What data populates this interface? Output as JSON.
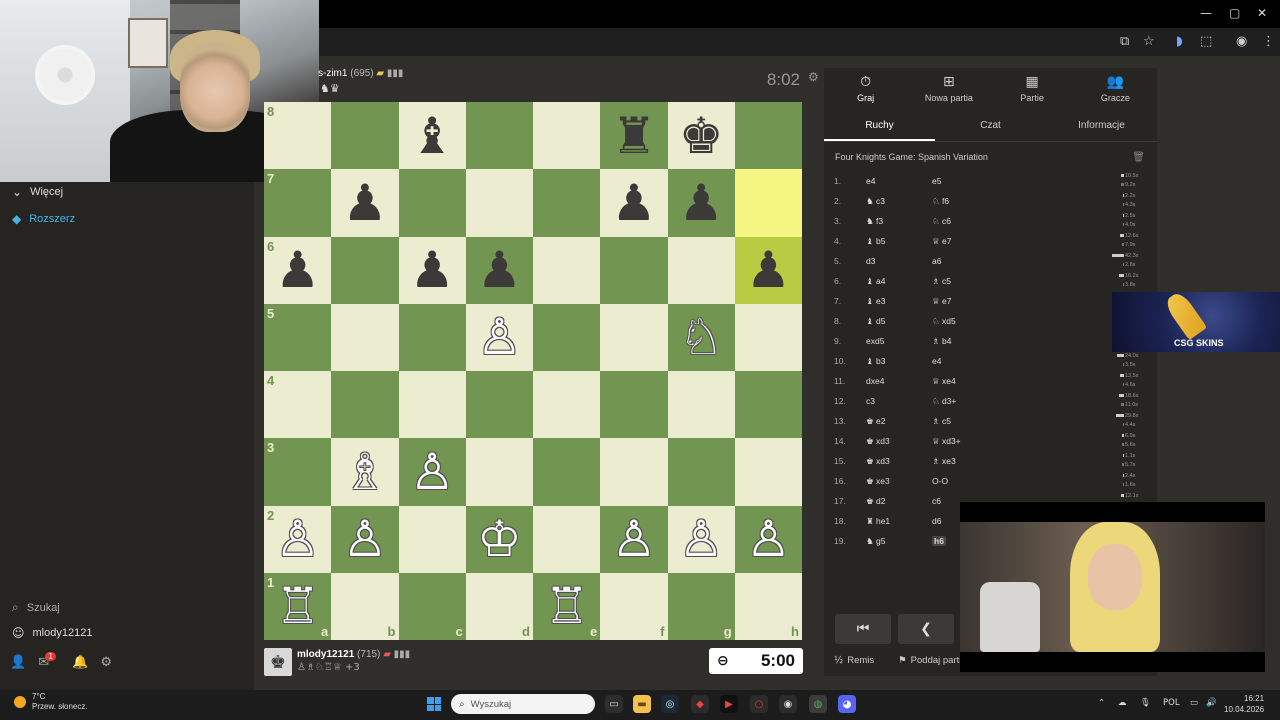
{
  "window": {
    "minimize": "—",
    "maximize": "▢",
    "close": "✕"
  },
  "sidebar": {
    "items": [
      {
        "label": "Więcej",
        "icon": "chevron-down-icon",
        "glyph": "⌄"
      },
      {
        "label": "Rozszerz",
        "icon": "gem-icon",
        "glyph": "◆"
      },
      {
        "label": "Szukaj",
        "icon": "search-icon",
        "glyph": "⌕"
      },
      {
        "label": "mlody12121",
        "icon": "avatar",
        "glyph": "☺"
      }
    ],
    "notification_count": "1"
  },
  "opponent": {
    "name": "s-zim1",
    "rating": "(695)",
    "captured": "♞♛",
    "clock": "8:02"
  },
  "player": {
    "name": "mlody12121",
    "rating": "(715)",
    "captured": "♙♗♘♖♕",
    "captured_extra": "+3",
    "clock": "5:00"
  },
  "board": {
    "files": [
      "a",
      "b",
      "c",
      "d",
      "e",
      "f",
      "g",
      "h"
    ],
    "ranks": [
      "8",
      "7",
      "6",
      "5",
      "4",
      "3",
      "2",
      "1"
    ],
    "highlight": [
      "h7",
      "h6"
    ],
    "pieces": [
      {
        "sq": "c8",
        "glyph": "♝",
        "color": "b"
      },
      {
        "sq": "f8",
        "glyph": "♜",
        "color": "b"
      },
      {
        "sq": "g8",
        "glyph": "♚",
        "color": "b"
      },
      {
        "sq": "b7",
        "glyph": "♟",
        "color": "b"
      },
      {
        "sq": "f7",
        "glyph": "♟",
        "color": "b"
      },
      {
        "sq": "g7",
        "glyph": "♟",
        "color": "b"
      },
      {
        "sq": "a6",
        "glyph": "♟",
        "color": "b"
      },
      {
        "sq": "c6",
        "glyph": "♟",
        "color": "b"
      },
      {
        "sq": "d6",
        "glyph": "♟",
        "color": "b"
      },
      {
        "sq": "h6",
        "glyph": "♟",
        "color": "b"
      },
      {
        "sq": "d5",
        "glyph": "♙",
        "color": "w"
      },
      {
        "sq": "g5",
        "glyph": "♘",
        "color": "w"
      },
      {
        "sq": "b3",
        "glyph": "♗",
        "color": "w"
      },
      {
        "sq": "c3",
        "glyph": "♙",
        "color": "w"
      },
      {
        "sq": "a2",
        "glyph": "♙",
        "color": "w"
      },
      {
        "sq": "b2",
        "glyph": "♙",
        "color": "w"
      },
      {
        "sq": "d2",
        "glyph": "♔",
        "color": "w"
      },
      {
        "sq": "f2",
        "glyph": "♙",
        "color": "w"
      },
      {
        "sq": "g2",
        "glyph": "♙",
        "color": "w"
      },
      {
        "sq": "h2",
        "glyph": "♙",
        "color": "w"
      },
      {
        "sq": "a1",
        "glyph": "♖",
        "color": "w"
      },
      {
        "sq": "e1",
        "glyph": "♖",
        "color": "w"
      }
    ]
  },
  "panel": {
    "tabs": [
      {
        "label": "Graj",
        "glyph": "⏱"
      },
      {
        "label": "Nowa partia",
        "glyph": "⊞"
      },
      {
        "label": "Partie",
        "glyph": "▦"
      },
      {
        "label": "Gracze",
        "glyph": "👥"
      }
    ],
    "subtabs": [
      "Ruchy",
      "Czat",
      "Informacje"
    ],
    "opening": "Four Knights Game: Spanish Variation",
    "moves": [
      {
        "n": "1.",
        "w": "e4",
        "b": "e5",
        "tw": "10.5s",
        "tb": "9.2s",
        "fw": 0.25,
        "fb": 0.22
      },
      {
        "n": "2.",
        "w": "♞ c3",
        "b": "♘ f6",
        "tw": "2.2s",
        "tb": "4.3s",
        "fw": 0.06,
        "fb": 0.1
      },
      {
        "n": "3.",
        "w": "♞ f3",
        "b": "♘ c6",
        "tw": "2.5s",
        "tb": "4.0s",
        "fw": 0.06,
        "fb": 0.1
      },
      {
        "n": "4.",
        "w": "♝ b5",
        "b": "♕ e7",
        "tw": "12.6s",
        "tb": "7.9s",
        "fw": 0.3,
        "fb": 0.19
      },
      {
        "n": "5.",
        "w": "d3",
        "b": "a6",
        "tw": "42.3s",
        "tb": "2.8s",
        "fw": 1.0,
        "fb": 0.07
      },
      {
        "n": "6.",
        "w": "♝ a4",
        "b": "♗ c5",
        "tw": "16.2s",
        "tb": "3.8s",
        "fw": 0.38,
        "fb": 0.09
      },
      {
        "n": "7.",
        "w": "♝ e3",
        "b": "♕ e7",
        "tw": "",
        "tb": "",
        "fw": 0,
        "fb": 0
      },
      {
        "n": "8.",
        "w": "♝ d5",
        "b": "♘ xd5",
        "tw": "",
        "tb": "",
        "fw": 0,
        "fb": 0
      },
      {
        "n": "9.",
        "w": "exd5",
        "b": "♗ b4",
        "tw": "",
        "tb": "",
        "fw": 0,
        "fb": 0
      },
      {
        "n": "10.",
        "w": "♝ b3",
        "b": "e4",
        "tw": "24.0s",
        "tb": "3.5s",
        "fw": 0.57,
        "fb": 0.08
      },
      {
        "n": "11.",
        "w": "dxe4",
        "b": "♕ xe4",
        "tw": "13.5s",
        "tb": "4.6s",
        "fw": 0.32,
        "fb": 0.11
      },
      {
        "n": "12.",
        "w": "c3",
        "b": "♘ d3+",
        "tw": "18.6s",
        "tb": "11.0s",
        "fw": 0.44,
        "fb": 0.26
      },
      {
        "n": "13.",
        "w": "♚ e2",
        "b": "♗ c5",
        "tw": "29.8s",
        "tb": "4.4s",
        "fw": 0.7,
        "fb": 0.1
      },
      {
        "n": "14.",
        "w": "♚ xd3",
        "b": "♕ xd3+",
        "tw": "6.9s",
        "tb": "5.6s",
        "fw": 0.16,
        "fb": 0.13
      },
      {
        "n": "15.",
        "w": "♚ xd3",
        "b": "♗ xe3",
        "tw": "1.1s",
        "tb": "5.7s",
        "fw": 0.03,
        "fb": 0.13
      },
      {
        "n": "16.",
        "w": "♚ xe3",
        "b": "O-O",
        "tw": "2.4s",
        "tb": "1.6s",
        "fw": 0.06,
        "fb": 0.04
      },
      {
        "n": "17.",
        "w": "♚ d2",
        "b": "c6",
        "tw": "12.1s",
        "tb": "",
        "fw": 0.29,
        "fb": 0
      },
      {
        "n": "18.",
        "w": "♜ he1",
        "b": "d6",
        "tw": "",
        "tb": "",
        "fw": 0,
        "fb": 0
      },
      {
        "n": "19.",
        "w": "♞ g5",
        "b": "h6",
        "tw": "",
        "tb": "",
        "fw": 0,
        "fb": 0,
        "current": true
      }
    ],
    "nav": {
      "first": "⏮",
      "prev": "❮"
    },
    "footer": {
      "draw": "Remis",
      "draw_glyph": "½",
      "resign": "Poddaj partię",
      "resign_glyph": "⚑"
    }
  },
  "ad": {
    "text": "CSG SKINS"
  },
  "taskbar": {
    "weather_temp": "7°C",
    "weather_desc": "Przew. słonecz.",
    "search_placeholder": "Wyszukaj",
    "lang": "POL",
    "time": "16:21",
    "date": "10.04.2026"
  },
  "colors": {
    "board_light": "#ebecd0",
    "board_dark": "#739552",
    "highlight": "#f5f682",
    "accent": "#3fb8e8"
  }
}
